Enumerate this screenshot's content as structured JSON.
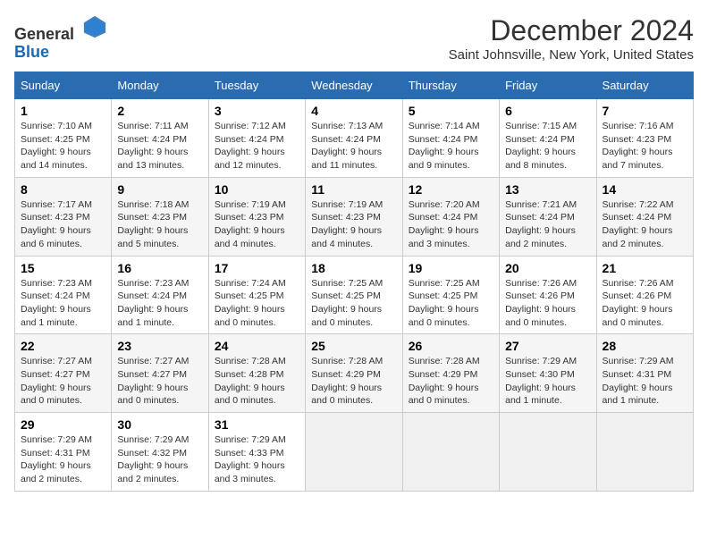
{
  "header": {
    "logo_general": "General",
    "logo_blue": "Blue",
    "title": "December 2024",
    "subtitle": "Saint Johnsville, New York, United States"
  },
  "calendar": {
    "days_of_week": [
      "Sunday",
      "Monday",
      "Tuesday",
      "Wednesday",
      "Thursday",
      "Friday",
      "Saturday"
    ],
    "weeks": [
      [
        {
          "day": "1",
          "sunrise": "7:10 AM",
          "sunset": "4:25 PM",
          "daylight": "9 hours and 14 minutes."
        },
        {
          "day": "2",
          "sunrise": "7:11 AM",
          "sunset": "4:24 PM",
          "daylight": "9 hours and 13 minutes."
        },
        {
          "day": "3",
          "sunrise": "7:12 AM",
          "sunset": "4:24 PM",
          "daylight": "9 hours and 12 minutes."
        },
        {
          "day": "4",
          "sunrise": "7:13 AM",
          "sunset": "4:24 PM",
          "daylight": "9 hours and 11 minutes."
        },
        {
          "day": "5",
          "sunrise": "7:14 AM",
          "sunset": "4:24 PM",
          "daylight": "9 hours and 9 minutes."
        },
        {
          "day": "6",
          "sunrise": "7:15 AM",
          "sunset": "4:24 PM",
          "daylight": "9 hours and 8 minutes."
        },
        {
          "day": "7",
          "sunrise": "7:16 AM",
          "sunset": "4:23 PM",
          "daylight": "9 hours and 7 minutes."
        }
      ],
      [
        {
          "day": "8",
          "sunrise": "7:17 AM",
          "sunset": "4:23 PM",
          "daylight": "9 hours and 6 minutes."
        },
        {
          "day": "9",
          "sunrise": "7:18 AM",
          "sunset": "4:23 PM",
          "daylight": "9 hours and 5 minutes."
        },
        {
          "day": "10",
          "sunrise": "7:19 AM",
          "sunset": "4:23 PM",
          "daylight": "9 hours and 4 minutes."
        },
        {
          "day": "11",
          "sunrise": "7:19 AM",
          "sunset": "4:23 PM",
          "daylight": "9 hours and 4 minutes."
        },
        {
          "day": "12",
          "sunrise": "7:20 AM",
          "sunset": "4:24 PM",
          "daylight": "9 hours and 3 minutes."
        },
        {
          "day": "13",
          "sunrise": "7:21 AM",
          "sunset": "4:24 PM",
          "daylight": "9 hours and 2 minutes."
        },
        {
          "day": "14",
          "sunrise": "7:22 AM",
          "sunset": "4:24 PM",
          "daylight": "9 hours and 2 minutes."
        }
      ],
      [
        {
          "day": "15",
          "sunrise": "7:23 AM",
          "sunset": "4:24 PM",
          "daylight": "9 hours and 1 minute."
        },
        {
          "day": "16",
          "sunrise": "7:23 AM",
          "sunset": "4:24 PM",
          "daylight": "9 hours and 1 minute."
        },
        {
          "day": "17",
          "sunrise": "7:24 AM",
          "sunset": "4:25 PM",
          "daylight": "9 hours and 0 minutes."
        },
        {
          "day": "18",
          "sunrise": "7:25 AM",
          "sunset": "4:25 PM",
          "daylight": "9 hours and 0 minutes."
        },
        {
          "day": "19",
          "sunrise": "7:25 AM",
          "sunset": "4:25 PM",
          "daylight": "9 hours and 0 minutes."
        },
        {
          "day": "20",
          "sunrise": "7:26 AM",
          "sunset": "4:26 PM",
          "daylight": "9 hours and 0 minutes."
        },
        {
          "day": "21",
          "sunrise": "7:26 AM",
          "sunset": "4:26 PM",
          "daylight": "9 hours and 0 minutes."
        }
      ],
      [
        {
          "day": "22",
          "sunrise": "7:27 AM",
          "sunset": "4:27 PM",
          "daylight": "9 hours and 0 minutes."
        },
        {
          "day": "23",
          "sunrise": "7:27 AM",
          "sunset": "4:27 PM",
          "daylight": "9 hours and 0 minutes."
        },
        {
          "day": "24",
          "sunrise": "7:28 AM",
          "sunset": "4:28 PM",
          "daylight": "9 hours and 0 minutes."
        },
        {
          "day": "25",
          "sunrise": "7:28 AM",
          "sunset": "4:29 PM",
          "daylight": "9 hours and 0 minutes."
        },
        {
          "day": "26",
          "sunrise": "7:28 AM",
          "sunset": "4:29 PM",
          "daylight": "9 hours and 0 minutes."
        },
        {
          "day": "27",
          "sunrise": "7:29 AM",
          "sunset": "4:30 PM",
          "daylight": "9 hours and 1 minute."
        },
        {
          "day": "28",
          "sunrise": "7:29 AM",
          "sunset": "4:31 PM",
          "daylight": "9 hours and 1 minute."
        }
      ],
      [
        {
          "day": "29",
          "sunrise": "7:29 AM",
          "sunset": "4:31 PM",
          "daylight": "9 hours and 2 minutes."
        },
        {
          "day": "30",
          "sunrise": "7:29 AM",
          "sunset": "4:32 PM",
          "daylight": "9 hours and 2 minutes."
        },
        {
          "day": "31",
          "sunrise": "7:29 AM",
          "sunset": "4:33 PM",
          "daylight": "9 hours and 3 minutes."
        },
        null,
        null,
        null,
        null
      ]
    ]
  },
  "labels": {
    "sunrise": "Sunrise:",
    "sunset": "Sunset:",
    "daylight": "Daylight:"
  }
}
